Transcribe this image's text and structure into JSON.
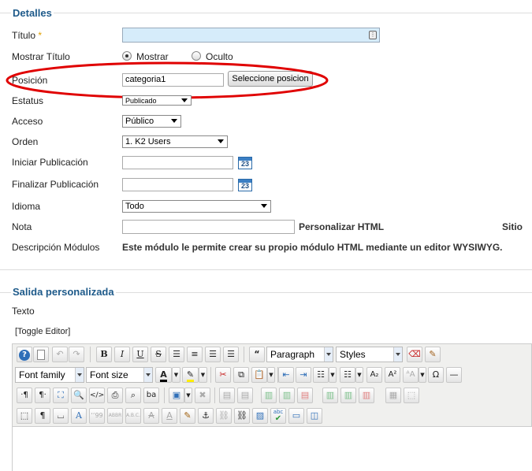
{
  "details": {
    "legend": "Detalles",
    "titulo": {
      "label": "Título",
      "required_mark": "*",
      "value": ""
    },
    "mostrar_titulo": {
      "label": "Mostrar Título",
      "option_yes": "Mostrar",
      "option_no": "Oculto",
      "selected": "Mostrar"
    },
    "posicion": {
      "label": "Posición",
      "value": "categoria1",
      "button": "Seleccione posicion"
    },
    "estatus": {
      "label": "Estatus",
      "value": "Publicado"
    },
    "acceso": {
      "label": "Acceso",
      "value": "Público"
    },
    "orden": {
      "label": "Orden",
      "value": "1. K2 Users"
    },
    "iniciar": {
      "label": "Iniciar Publicación",
      "value": "",
      "calendar": "23"
    },
    "finalizar": {
      "label": "Finalizar Publicación",
      "value": "",
      "calendar": "23"
    },
    "idioma": {
      "label": "Idioma",
      "value": "Todo"
    },
    "nota": {
      "label": "Nota",
      "value": "",
      "module_type": "Personalizar HTML",
      "client": "Sitio"
    },
    "descripcion": {
      "label": "Descripción Módulos",
      "text": "Este módulo le permite crear su propio módulo HTML mediante un editor WYSIWYG."
    }
  },
  "custom_output": {
    "legend": "Salida personalizada",
    "texto_label": "Texto",
    "toggle_editor": "[Toggle Editor]"
  },
  "toolbar": {
    "paragraph": "Paragraph",
    "styles": "Styles",
    "font_family": "Font family",
    "font_size": "Font size",
    "glyphs": {
      "bold": "B",
      "italic": "I",
      "underline": "U",
      "strike": "S",
      "quote": "“",
      "omega": "Ω",
      "subscript": "A₂",
      "superscript": "A²",
      "text_color": "A",
      "pilcrow_ltr": "·¶",
      "pilcrow_rtl": "¶·",
      "pilcrow": "¶",
      "ba": "ba",
      "abbr": "ABBR",
      "abc": "A.B.C.",
      "quotes": "‘‘99",
      "font_a": "A",
      "spell": "abc"
    }
  },
  "colors": {
    "accent": "#1e5a8a",
    "title_field": "#d6ecfa",
    "highlight_oval": "#e00000"
  }
}
